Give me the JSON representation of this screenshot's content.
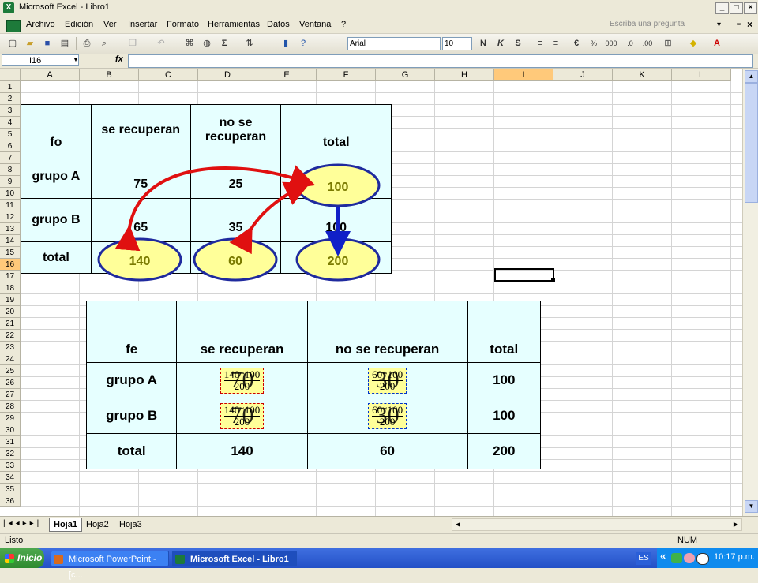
{
  "window": {
    "title": "Microsoft Excel - Libro1",
    "app_icon": "X"
  },
  "menu": [
    "Archivo",
    "Edición",
    "Ver",
    "Insertar",
    "Formato",
    "Herramientas",
    "Datos",
    "Ventana",
    "?"
  ],
  "help_placeholder": "Escriba una pregunta",
  "toolbar": {
    "font": "Arial",
    "size": "10",
    "bold": "N",
    "italic": "K",
    "underline": "S",
    "euro": "€"
  },
  "formula": {
    "cell_ref": "I16",
    "fx": "fx",
    "value": ""
  },
  "columns": [
    "A",
    "B",
    "C",
    "D",
    "E",
    "F",
    "G",
    "H",
    "I",
    "J",
    "K",
    "L"
  ],
  "rows": [
    "1",
    "2",
    "3",
    "4",
    "5",
    "6",
    "7",
    "8",
    "9",
    "10",
    "11",
    "12",
    "13",
    "14",
    "15",
    "16",
    "17",
    "18",
    "19",
    "20",
    "21",
    "22",
    "23",
    "24",
    "25",
    "26",
    "27",
    "28",
    "29",
    "30",
    "31",
    "32",
    "33",
    "34",
    "35",
    "36"
  ],
  "table_observed": {
    "header": [
      "fo",
      "se recuperan",
      "no se recuperan",
      "total"
    ],
    "rows": [
      [
        "grupo A",
        "75",
        "25",
        "100"
      ],
      [
        "grupo B",
        "65",
        "35",
        "100"
      ],
      [
        "total",
        "140",
        "60",
        "200"
      ]
    ]
  },
  "table_expected": {
    "header": [
      "fe",
      "se recuperan",
      "no se recuperan",
      "total"
    ],
    "rows": [
      {
        "label": "grupo A",
        "c1_num": "140*100",
        "c1_den": "200",
        "c1_val": "70",
        "c2_num": "60*100",
        "c2_den": "200",
        "c2_val": "30",
        "total": "100"
      },
      {
        "label": "grupo B",
        "c1_num": "140*100",
        "c1_den": "200",
        "c1_val": "70",
        "c2_num": "60*100",
        "c2_den": "200",
        "c2_val": "30",
        "total": "100"
      }
    ],
    "total_row": [
      "total",
      "140",
      "60",
      "200"
    ]
  },
  "sheets": [
    "Hoja1",
    "Hoja2",
    "Hoja3"
  ],
  "status": {
    "left": "Listo",
    "right": "NUM"
  },
  "taskbar": {
    "start": "Inicio",
    "tasks": [
      "Microsoft PowerPoint - [c...",
      "Microsoft Excel - Libro1"
    ],
    "lang": "ES",
    "clock": "10:17 p.m."
  },
  "colors": {
    "table_bg": "#e6ffff",
    "ellipse_fill": "#ffff99",
    "ellipse_stroke": "#1f2a9e",
    "arrow_red": "#e01010",
    "arrow_blue": "#1020c8"
  }
}
